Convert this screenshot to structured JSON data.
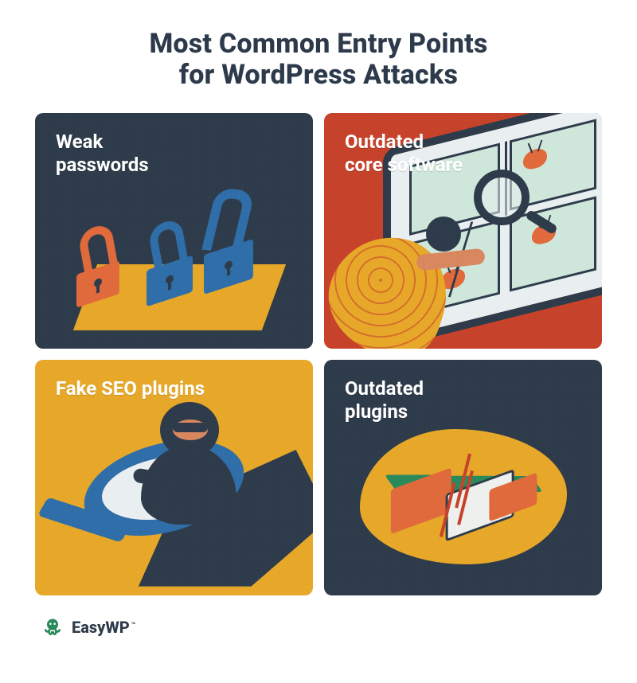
{
  "title_lines": [
    "Most Common Entry Points",
    "for WordPress Attacks"
  ],
  "cards": {
    "weak_passwords": {
      "label": "Weak\npasswords",
      "bg": "#2e3b4a"
    },
    "outdated_core": {
      "label": "Outdated\ncore software",
      "bg": "#c6422b"
    },
    "fake_seo": {
      "label": "Fake SEO plugins",
      "bg": "#e7a82a"
    },
    "outdated_plugins": {
      "label": "Outdated\nplugins",
      "bg": "#2e3b4a"
    }
  },
  "palette": {
    "navy": "#2e3b4a",
    "rust": "#c6422b",
    "amber": "#e7a82a",
    "orange": "#e06a3b",
    "blue": "#2f6ea8",
    "green": "#2a8a5c",
    "white": "#ffffff"
  },
  "brand": {
    "name": "EasyWP",
    "trademark": "™"
  },
  "icons": {
    "octopus": "octopus-icon",
    "padlock": "padlock-icon",
    "magnifier": "magnifier-icon",
    "bug": "bug-icon",
    "puzzle_block": "broken-puzzle-icon",
    "thief": "thief-icon",
    "monitor": "monitor-icon"
  }
}
